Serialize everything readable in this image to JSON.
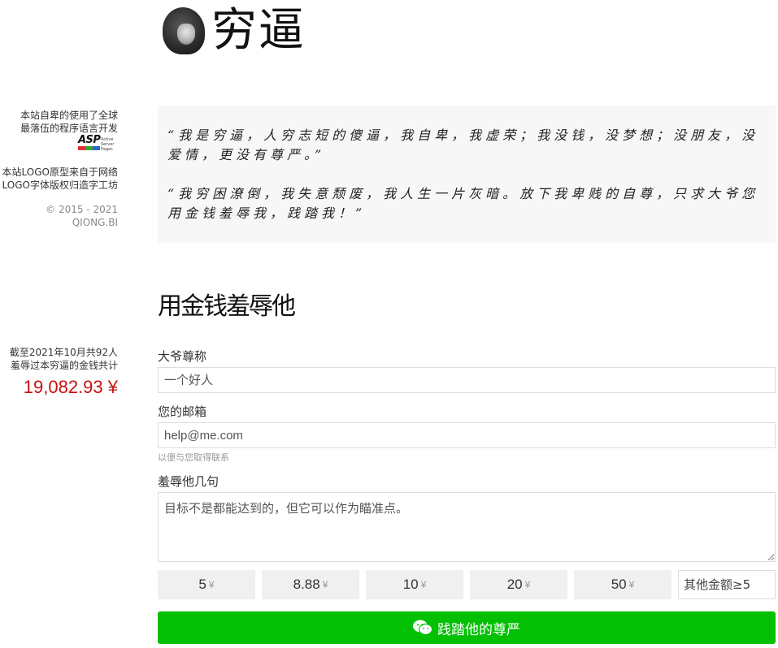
{
  "header": {
    "site_title": "穷逼",
    "logo_icon": "face-portrait-icon"
  },
  "sidebar": {
    "built_with_line1": "本站自卑的使用了全球",
    "built_with_line2": "最落伍的程序语言开发",
    "asp_badge": {
      "big": "ASP",
      "small_line1": "Active",
      "small_line2": "Server Pages"
    },
    "logo_credit_line1": "本站LOGO原型来自于网络",
    "logo_credit_line2": "LOGO字体版权归造字工坊",
    "copyright": "© 2015 - 2021 QIONG.BI",
    "stats_line1": "截至2021年10月共92人",
    "stats_line2": "羞辱过本穷逼的金钱共计",
    "total_amount": "19,082.93 ¥"
  },
  "quote": {
    "para1": "“我是穷逼，人穷志短的傻逼，我自卑，我虚荣；我没钱，没梦想；没朋友，没爱情，更没有尊严。”",
    "para2": "“我穷困潦倒，我失意颓废，我人生一片灰暗。放下我卑贱的自尊，只求大爷您用金钱羞辱我，践踏我！”"
  },
  "form": {
    "title": "用金钱羞辱他",
    "name_label": "大爷尊称",
    "name_placeholder": "一个好人",
    "email_label": "您的邮箱",
    "email_placeholder": "help@me.com",
    "email_help": "以便与您取得联系",
    "message_label": "羞辱他几句",
    "message_placeholder": "目标不是都能达到的，但它可以作为瞄准点。",
    "amounts": [
      "5",
      "8.88",
      "10",
      "20",
      "50"
    ],
    "currency_symbol": "¥",
    "custom_amount_placeholder": "其他金额≥5",
    "submit_label": "践踏他的尊严",
    "submit_icon": "wechat-icon"
  },
  "colors": {
    "accent_green": "#04c004",
    "amount_red": "#c81010",
    "quote_bg": "#f7f7f7"
  }
}
